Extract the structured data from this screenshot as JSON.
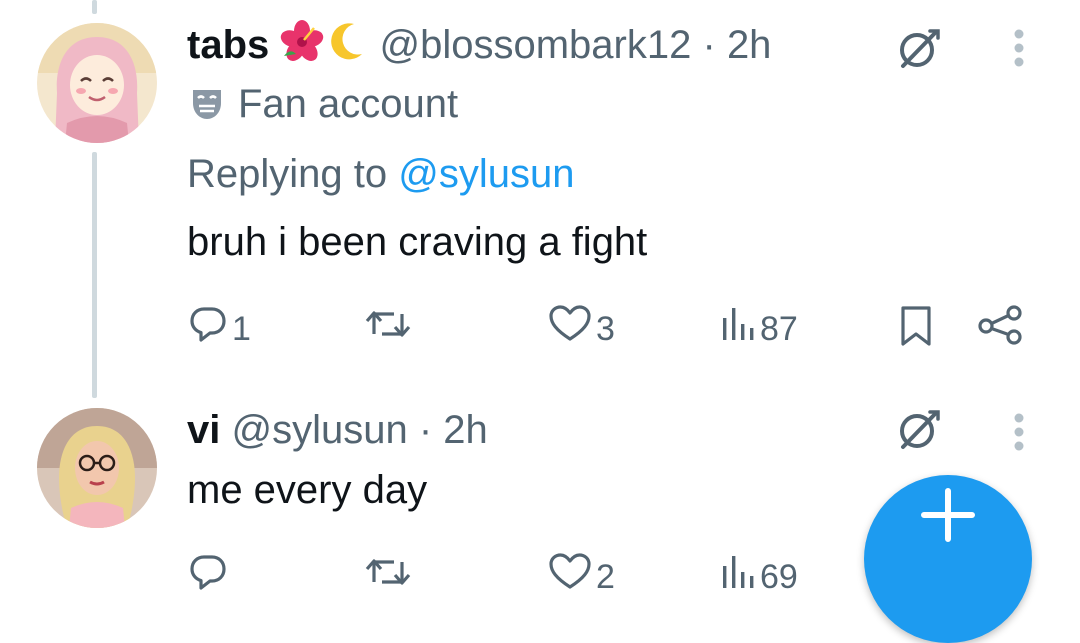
{
  "tweets": [
    {
      "display_name": "tabs",
      "emojis": [
        "hibiscus",
        "crescent-moon"
      ],
      "handle": "@blossombark12",
      "separator": "·",
      "time": "2h",
      "label": "Fan account",
      "replying_prefix": "Replying to",
      "replying_handle": "@sylusun",
      "text": "bruh i been craving a fight",
      "actions": {
        "reply_count": "1",
        "retweet_count": "",
        "like_count": "3",
        "view_count": "87"
      }
    },
    {
      "display_name": "vi",
      "handle": "@sylusun",
      "separator": "·",
      "time": "2h",
      "text": "me every day",
      "actions": {
        "reply_count": "",
        "retweet_count": "",
        "like_count": "2",
        "view_count": "69"
      }
    }
  ],
  "icons": {
    "reply": "reply-icon",
    "retweet": "retweet-icon",
    "like": "like-icon",
    "views": "views-icon",
    "bookmark": "bookmark-icon",
    "share": "share-icon",
    "grok": "grok-icon",
    "more": "more-icon",
    "compose": "compose-plus-icon"
  },
  "colors": {
    "accent": "#1d9bf0",
    "secondary_text": "#536471",
    "primary_text": "#0f1419",
    "thread_line": "#cfd9de"
  }
}
